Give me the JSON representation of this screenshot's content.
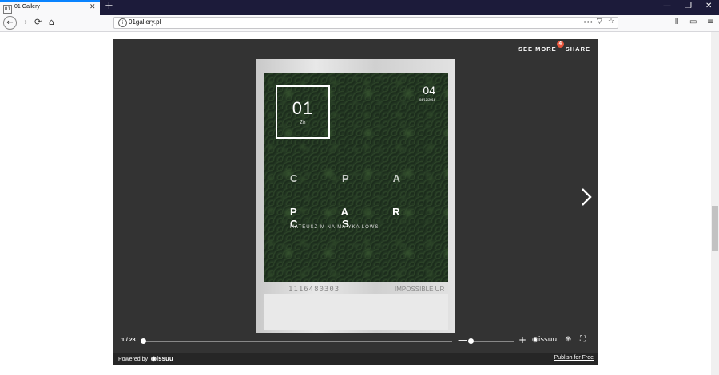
{
  "browser": {
    "tab_title": "01 Gallery",
    "tab_favicon": "01",
    "tab_close": "✕",
    "new_tab": "+",
    "window_controls": {
      "minimize": "—",
      "restore": "❐",
      "close": "✕"
    },
    "nav": {
      "back": "←",
      "forward": "→",
      "reload": "⟳",
      "home": "⌂"
    },
    "url_info": "i",
    "url": "01gallery.pl",
    "url_actions": {
      "more": "•••",
      "pocket": "▽",
      "bookmark": "☆"
    },
    "toolbar_icons": {
      "library": "⫴",
      "sidebar": "▭",
      "menu": "≡"
    }
  },
  "viewer": {
    "see_more_label": "SEE MORE",
    "see_more_badge": "4",
    "share_label": "SHARE",
    "page_indicator": "1 / 28",
    "progress_fraction": 0.0,
    "zoom_fraction": 0.0,
    "zoom_minus": "—",
    "zoom_plus": "+",
    "issuu_brand": "issuu",
    "zoom_icon": "⊕",
    "fullscreen_icon": "⛶",
    "footer_powered": "Powered by",
    "footer_brand": "issuu",
    "footer_publish": "Publish for Free"
  },
  "document": {
    "logo_number": "01",
    "logo_subtitle": "Zin",
    "issue_number": "04",
    "issue_date": "04/12/2018",
    "title_line1": "C P   A",
    "title_line2": "P A R C S",
    "authors": "MATEUSZ M   NA   MA  YKA  LOWS",
    "barcode": "1116480303",
    "brand_strip": "IMPOSSIBLE UR"
  }
}
